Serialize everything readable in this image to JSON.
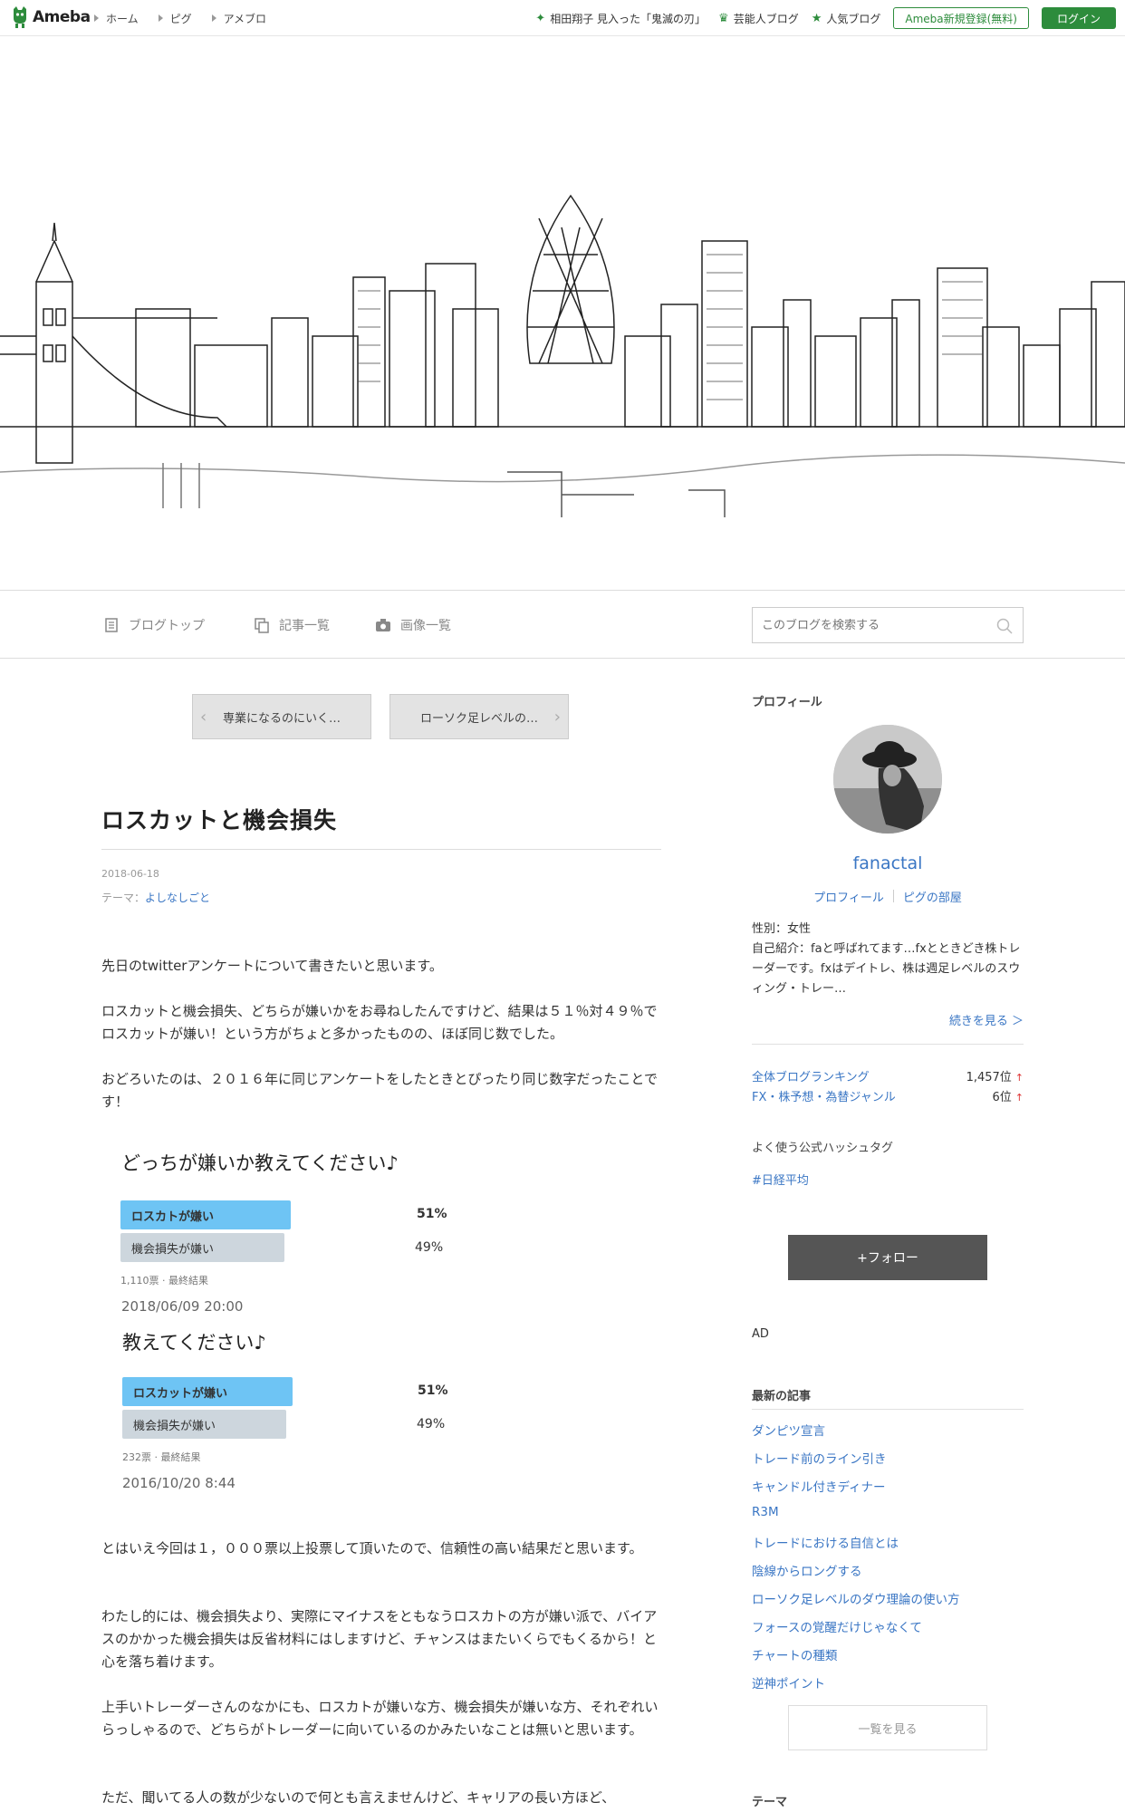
{
  "header": {
    "logo": "Ameba",
    "crumbs": [
      "ホーム",
      "ピグ",
      "アメブロ"
    ],
    "trend": "相田翔子 見入った「鬼滅の刃」",
    "celeb": "芸能人ブログ",
    "popular": "人気ブログ",
    "register": "Ameba新規登録(無料)",
    "login": "ログイン"
  },
  "blognav": {
    "top": "ブログトップ",
    "articles": "記事一覧",
    "images": "画像一覧",
    "search_placeholder": "このブログを検索する"
  },
  "pager": {
    "prev": "専業になるのにいく…",
    "next": "ローソク足レベルの…"
  },
  "article": {
    "title": "ロスカットと機会損失",
    "date": "2018-06-18",
    "theme_label": "テーマ：",
    "theme": "よしなしごと",
    "p1": "先日のtwitterアンケートについて書きたいと思います。",
    "p2": "ロスカットと機会損失、どちらが嫌いかをお尋ねしたんですけど、結果は５１％対４９％でロスカットが嫌い！という方がちょと多かったものの、ほぼ同じ数でした。",
    "p3": "おどろいたのは、２０１６年に同じアンケートをしたときとぴったり同じ数字だったことです！",
    "p4": "とはいえ今回は１，０００票以上投票して頂いたので、信頼性の高い結果だと思います。",
    "p5": "わたし的には、機会損失より、実際にマイナスをともなうロスカトの方が嫌い派で、バイアスのかかった機会損失は反省材料にはしますけど、チャンスはまたいくらでもくるから！と心を落ち着けます。",
    "p6": "上手いトレーダーさんのなかにも、ロスカトが嫌いな方、機会損失が嫌いな方、それぞれいらっしゃるので、どちらがトレーダーに向いているのかみたいなことは無いと思います。",
    "p7": "ただ、聞いてる人の数が少ないので何とも言えませんけど、キャリアの長い方ほど、"
  },
  "polls": [
    {
      "question": "どっちが嫌いか教えてください♪",
      "opt1": "ロスカトが嫌い",
      "pct1": "51%",
      "opt2": "機会損失が嫌い",
      "pct2": "49%",
      "meta": "1,110票 · 最終結果",
      "date": "2018/06/09 20:00"
    },
    {
      "question": "教えてください♪",
      "opt1": "ロスカットが嫌い",
      "pct1": "51%",
      "opt2": "機会損失が嫌い",
      "pct2": "49%",
      "meta": "232票 · 最終結果",
      "date": "2016/10/20 8:44"
    }
  ],
  "sidebar": {
    "profile_heading": "プロフィール",
    "name": "fanactal",
    "link_profile": "プロフィール",
    "link_pig": "ピグの部屋",
    "gender": "性別：女性",
    "intro": "自己紹介：faと呼ばれてます…fxとときどき株トレーダーです。fxはデイトレ、株は週足レベルのスウィング・トレー…",
    "more": "続きを見る ＞",
    "rank_all_label": "全体ブログランキング",
    "rank_all_value": "1,457位",
    "rank_genre_label": "FX・株予想・為替ジャンル",
    "rank_genre_value": "6位",
    "hashtag_heading": "よく使う公式ハッシュタグ",
    "hashtag": "#日経平均",
    "follow": "+フォロー",
    "ad": "AD",
    "recent_heading": "最新の記事",
    "recent": [
      "ダンピツ宣言",
      "トレード前のライン引き",
      "キャンドル付きディナー",
      "R3M",
      "トレードにおける自信とは",
      "陰線からロングする",
      "ローソク足レベルのダウ理論の使い方",
      "フォースの覚醒だけじゃなくて",
      "チャートの種類",
      "逆神ポイント"
    ],
    "list_more": "一覧を見る",
    "theme_heading": "テーマ"
  }
}
